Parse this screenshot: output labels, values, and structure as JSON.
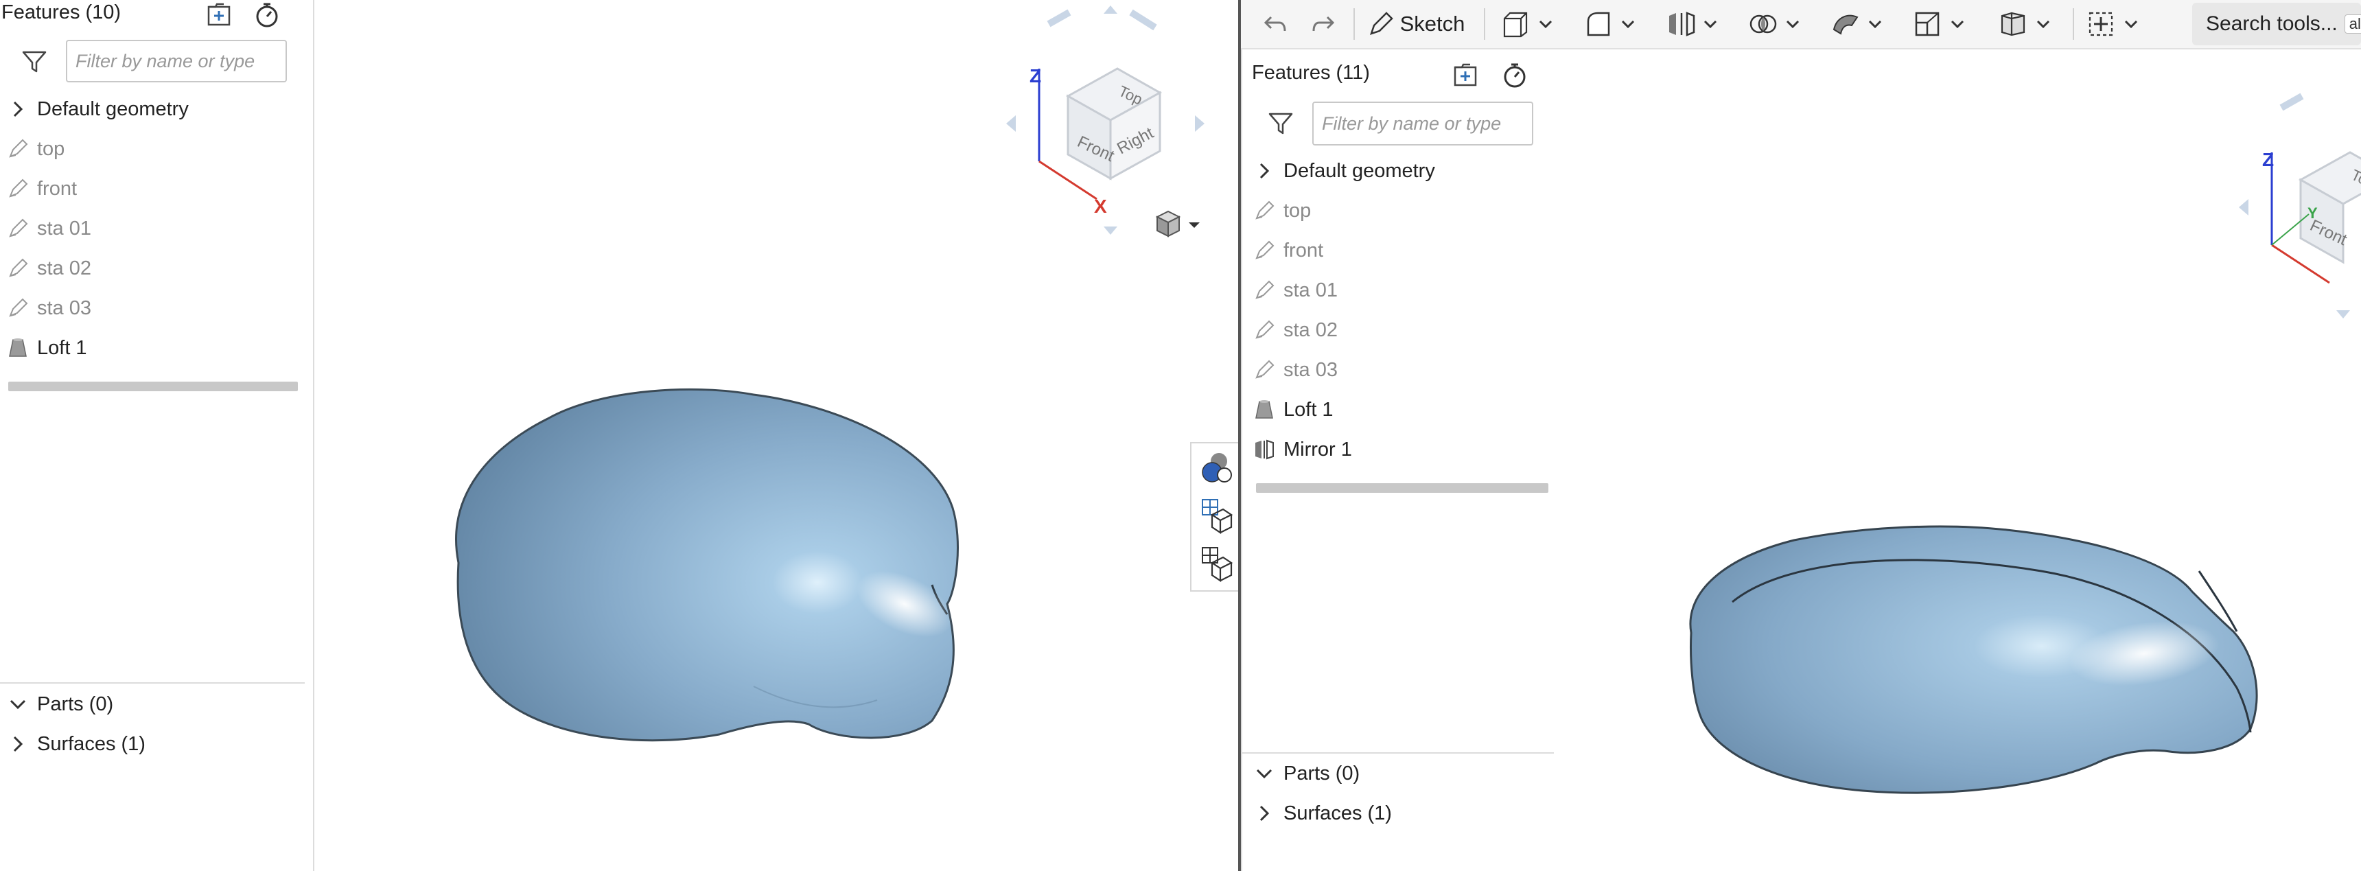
{
  "left": {
    "features_title": "Features (10)",
    "filter_placeholder": "Filter by name or type",
    "default_geometry": "Default geometry",
    "features": [
      {
        "label": "top",
        "kind": "sketch"
      },
      {
        "label": "front",
        "kind": "sketch"
      },
      {
        "label": "sta 01",
        "kind": "sketch"
      },
      {
        "label": "sta 02",
        "kind": "sketch"
      },
      {
        "label": "sta 03",
        "kind": "sketch"
      },
      {
        "label": "Loft 1",
        "kind": "loft"
      }
    ],
    "parts": "Parts (0)",
    "surfaces": "Surfaces (1)"
  },
  "right": {
    "features_title": "Features (11)",
    "filter_placeholder": "Filter by name or type",
    "default_geometry": "Default geometry",
    "features": [
      {
        "label": "top",
        "kind": "sketch"
      },
      {
        "label": "front",
        "kind": "sketch"
      },
      {
        "label": "sta 01",
        "kind": "sketch"
      },
      {
        "label": "sta 02",
        "kind": "sketch"
      },
      {
        "label": "sta 03",
        "kind": "sketch"
      },
      {
        "label": "Loft 1",
        "kind": "loft"
      },
      {
        "label": "Mirror 1",
        "kind": "mirror"
      }
    ],
    "parts": "Parts (0)",
    "surfaces": "Surfaces (1)"
  },
  "toolbar": {
    "sketch_label": "Sketch",
    "search_label": "Search tools...",
    "search_shortcut": "alt"
  },
  "view_cube": {
    "top": "Top",
    "front": "Front",
    "right": "Right",
    "axis_x": "X",
    "axis_z": "Z",
    "axis_y": "Y"
  },
  "colors": {
    "surface": "#8fb3cf",
    "surface_dark": "#5e87a6",
    "accent": "#2f6fb5",
    "muted_text": "#8a8a8a",
    "axis_x": "#d43a2f",
    "axis_z": "#2b3fd1",
    "axis_y": "#3aa34a"
  },
  "icons": [
    "filter-icon",
    "add-folder-icon",
    "stopwatch-icon",
    "chevron-right-icon",
    "chevron-down-icon",
    "pencil-icon",
    "loft-icon",
    "mirror-icon",
    "feature-list-icon",
    "view-cube-menu-icon",
    "undo-icon",
    "redo-icon"
  ]
}
